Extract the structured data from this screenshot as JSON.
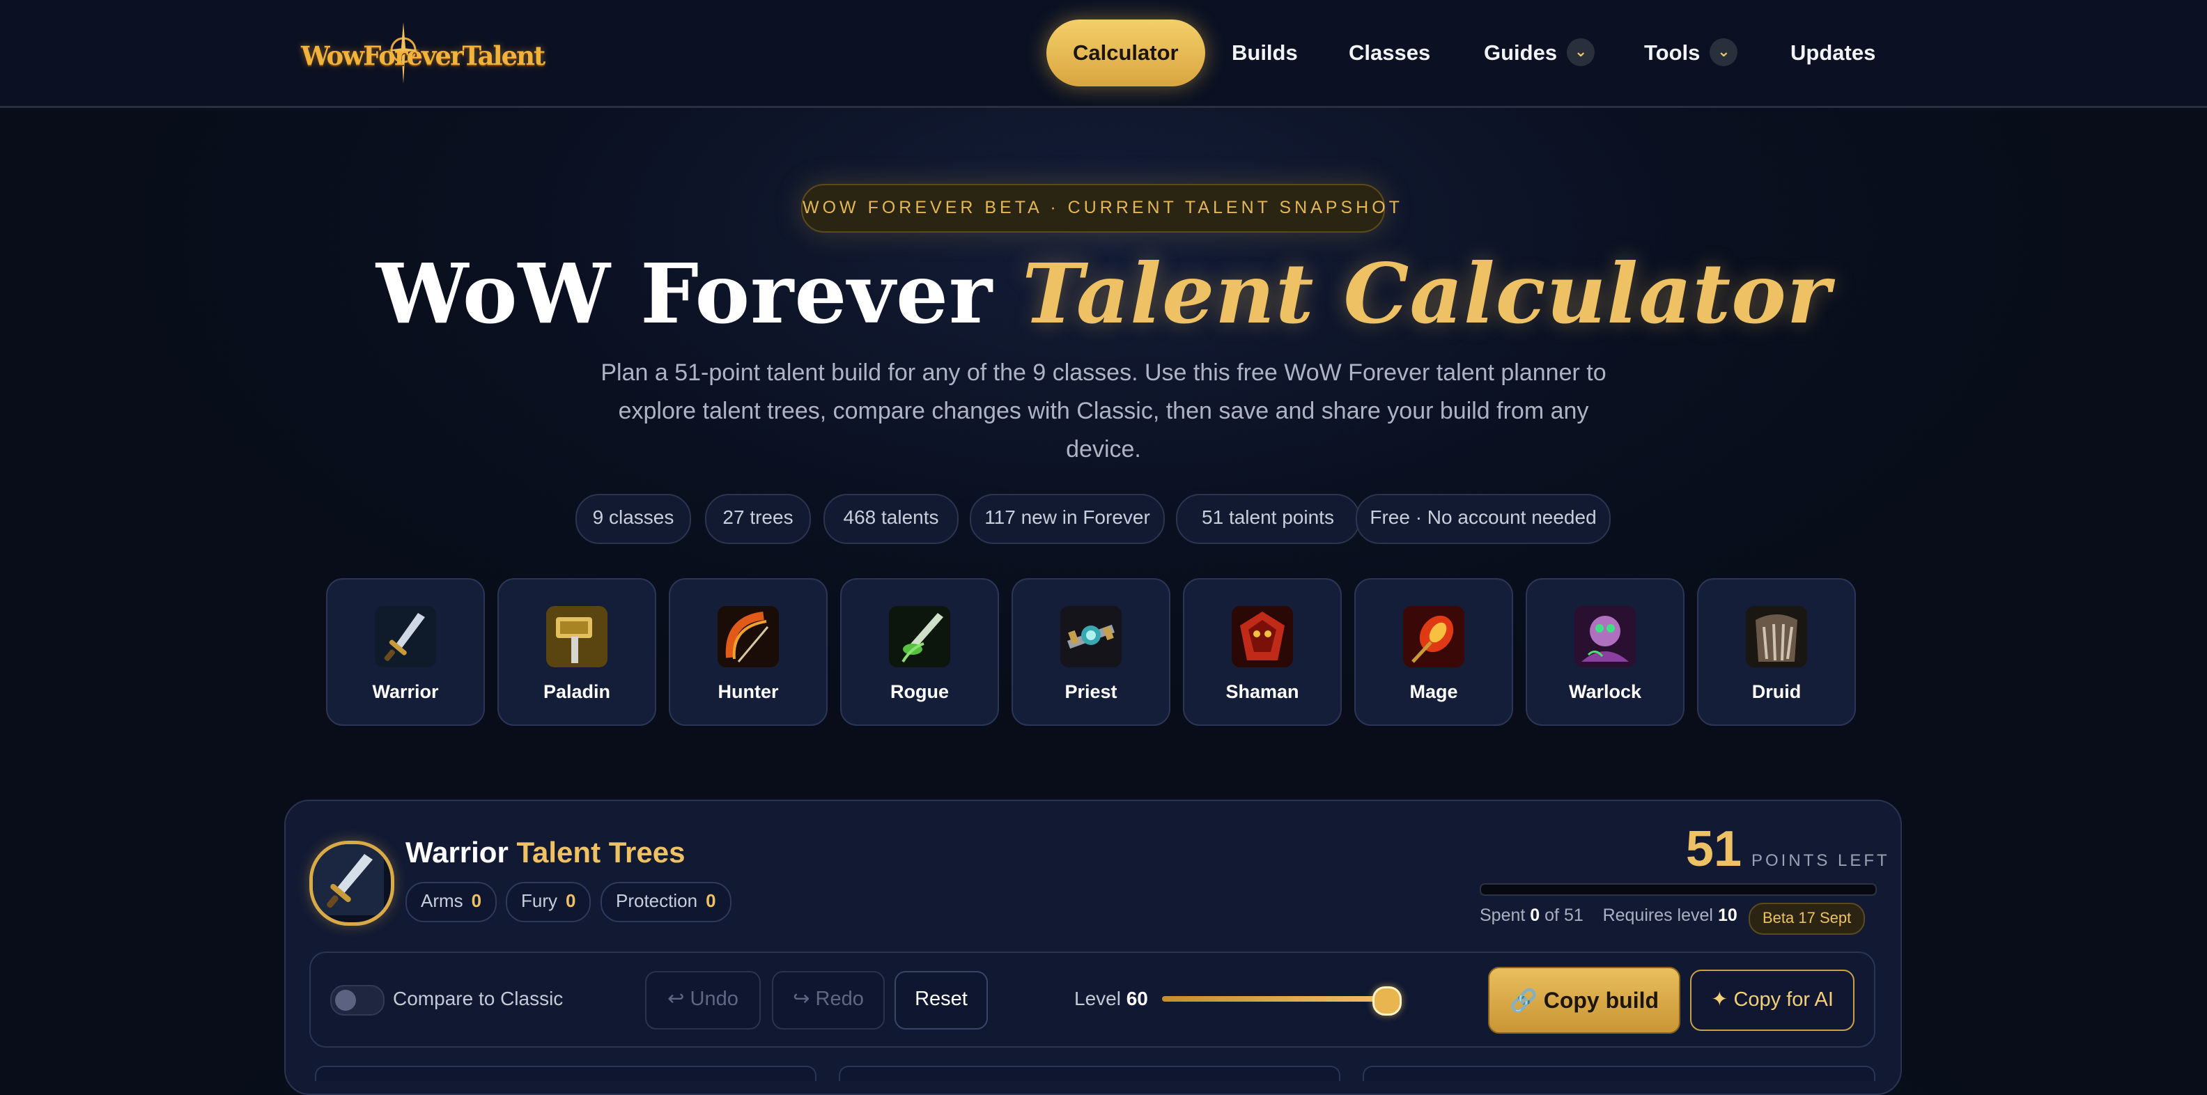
{
  "nav": {
    "logo_text": "WowForeverTalent",
    "items": [
      {
        "label": "Calculator",
        "active": true
      },
      {
        "label": "Builds"
      },
      {
        "label": "Classes"
      },
      {
        "label": "Guides",
        "dropdown": true
      },
      {
        "label": "Tools",
        "dropdown": true
      },
      {
        "label": "Updates"
      }
    ],
    "caret": "⌄"
  },
  "hero": {
    "badge": "WOW FOREVER BETA · CURRENT TALENT SNAPSHOT",
    "title_white": "WoW Forever ",
    "title_gold": "Talent Calculator",
    "subtitle": "Plan a 51-point talent build for any of the 9 classes. Use this free WoW Forever talent planner to explore talent trees, compare changes with Classic, then save and share your build from any device.",
    "stats": [
      "9 classes",
      "27 trees",
      "468 talents",
      "117 new in Forever",
      "51 talent points",
      "Free · No account needed"
    ]
  },
  "classes": [
    {
      "name": "Warrior",
      "icon": "sword-icon",
      "color": "#3b5b78"
    },
    {
      "name": "Paladin",
      "icon": "hammer-icon",
      "color": "#8a6a22"
    },
    {
      "name": "Hunter",
      "icon": "bow-icon",
      "color": "#8a2a0c"
    },
    {
      "name": "Rogue",
      "icon": "dagger-icon",
      "color": "#2b5a2a"
    },
    {
      "name": "Priest",
      "icon": "staff-icon",
      "color": "#3a3a44"
    },
    {
      "name": "Shaman",
      "icon": "totem-icon",
      "color": "#7a1a14"
    },
    {
      "name": "Mage",
      "icon": "fire-icon",
      "color": "#7a1a10"
    },
    {
      "name": "Warlock",
      "icon": "fel-icon",
      "color": "#5a2a60"
    },
    {
      "name": "Druid",
      "icon": "paw-icon",
      "color": "#5a4a3a"
    }
  ],
  "panel": {
    "class_name": "Warrior",
    "title_suffix": "Talent Trees",
    "trees": [
      {
        "name": "Arms",
        "points": "0"
      },
      {
        "name": "Fury",
        "points": "0"
      },
      {
        "name": "Protection",
        "points": "0"
      }
    ],
    "points_left": "51",
    "points_left_label": "POINTS LEFT",
    "spent_prefix": "Spent",
    "spent": "0",
    "spent_of": "of 51",
    "requires_prefix": "Requires level",
    "requires_level": "10",
    "beta_tag": "Beta 17 Sept",
    "points_spent_fraction": 0
  },
  "toolbar": {
    "compare_label": "Compare to Classic",
    "compare_on": false,
    "undo": "↩ Undo",
    "redo": "↪ Redo",
    "reset": "Reset",
    "level_label": "Level",
    "level_value": "60",
    "copy_build": "🔗 Copy build",
    "copy_ai": "✦ Copy for AI"
  },
  "colors": {
    "accent": "#eec164",
    "background": "#0a1020",
    "panel": "#121a33"
  }
}
